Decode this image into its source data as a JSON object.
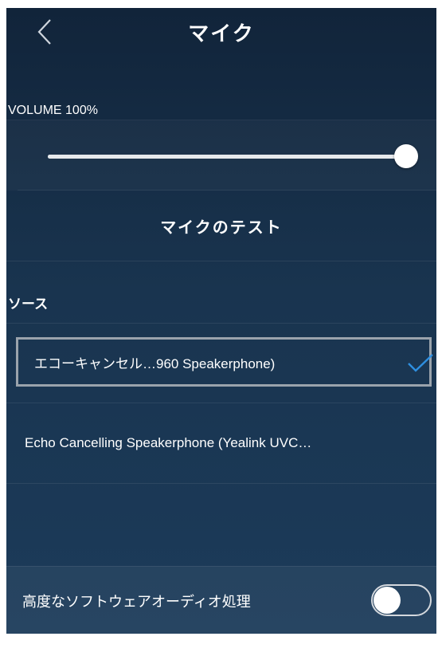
{
  "header": {
    "title": "マイク",
    "back_icon": "chevron-left-icon"
  },
  "volume": {
    "label": "VOLUME 100%",
    "level_percent": 100
  },
  "test": {
    "label": "マイクのテスト"
  },
  "source": {
    "section_label": "ソース",
    "items": [
      {
        "label": "エコーキャンセル…960 Speakerphone)",
        "selected": true,
        "check_icon": "checkmark-icon"
      },
      {
        "label": "Echo Cancelling Speakerphone (Yealink UVC…",
        "selected": false
      }
    ]
  },
  "advanced": {
    "label": "高度なソフトウェアオーディオ処理",
    "toggle_on": false
  },
  "colors": {
    "accent_check": "#2e8fe0",
    "background_top": "#11243a",
    "background_bottom": "#1c3b5a"
  }
}
